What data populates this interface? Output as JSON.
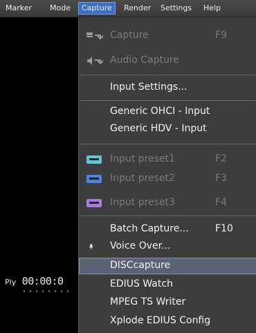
{
  "menubar": {
    "items": [
      "Marker",
      "Mode",
      "Capture",
      "Render",
      "Settings",
      "Help"
    ],
    "active_index": 2
  },
  "preview": {
    "timecode_prefix": "Ply",
    "timecode": "00:00:0"
  },
  "capture_menu": {
    "items": [
      {
        "label": "Capture",
        "shortcut": "F9",
        "enabled": false,
        "icon": "capture-icon"
      },
      {
        "label": "Audio Capture",
        "shortcut": "",
        "enabled": false,
        "icon": "audio-capture-icon"
      },
      {
        "label": "Input Settings...",
        "shortcut": "",
        "enabled": true
      },
      {
        "label": "Generic OHCI - Input",
        "shortcut": "",
        "enabled": true
      },
      {
        "label": "Generic HDV - Input",
        "shortcut": "",
        "enabled": true
      },
      {
        "label": "Input preset1",
        "shortcut": "F2",
        "enabled": false,
        "icon": "input-preset-icon",
        "icon_color": "#5fc6d8"
      },
      {
        "label": "Input preset2",
        "shortcut": "F3",
        "enabled": false,
        "icon": "input-preset-icon",
        "icon_color": "#4a86e8"
      },
      {
        "label": "Input preset3",
        "shortcut": "F4",
        "enabled": false,
        "icon": "input-preset-icon",
        "icon_color": "#a57be0"
      },
      {
        "label": "Batch Capture...",
        "shortcut": "F10",
        "enabled": true
      },
      {
        "label": "Voice Over...",
        "shortcut": "",
        "enabled": true,
        "icon": "microphone-icon"
      },
      {
        "label": "DISCcapture",
        "shortcut": "",
        "enabled": true,
        "highlighted": true
      },
      {
        "label": "EDIUS Watch",
        "shortcut": "",
        "enabled": true
      },
      {
        "label": "MPEG TS Writer",
        "shortcut": "",
        "enabled": true
      },
      {
        "label": "Xplode EDIUS Config",
        "shortcut": "",
        "enabled": true
      }
    ]
  },
  "colors": {
    "menubar_active": "#3b6fc7",
    "menu_bg": "#3d3d3d",
    "highlight": "#5a6274"
  }
}
